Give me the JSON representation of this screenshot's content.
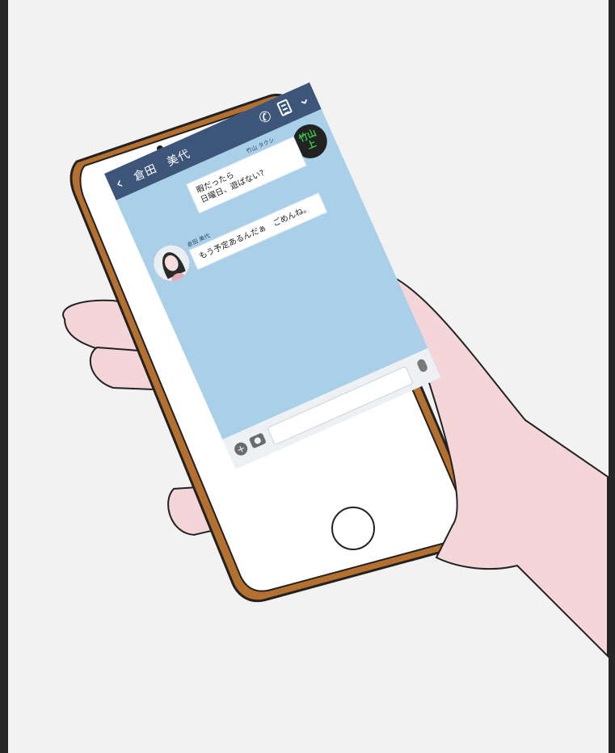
{
  "chat": {
    "contact_name": "倉田　美代",
    "icons": {
      "back": "chevron-left-icon",
      "call": "phone-icon",
      "memo": "clipboard-icon",
      "menu": "chevron-down-icon",
      "attach": "plus-icon",
      "camera": "camera-icon",
      "voice": "mic-icon"
    },
    "messages": [
      {
        "sender": "竹山 タクシ",
        "lines": [
          "暇だったら",
          "日曜日、遊ばない?"
        ]
      },
      {
        "sender": "倉田 美代",
        "lines": [
          "もう予定あるんだぁ　ごめんね。"
        ]
      }
    ],
    "badge_text": [
      "竹山",
      "上"
    ]
  },
  "colors": {
    "header": "#3d5578",
    "chat_bg": "#a9cfe9",
    "phone_case": "#b56f2e",
    "skin": "#f5d6d8"
  }
}
